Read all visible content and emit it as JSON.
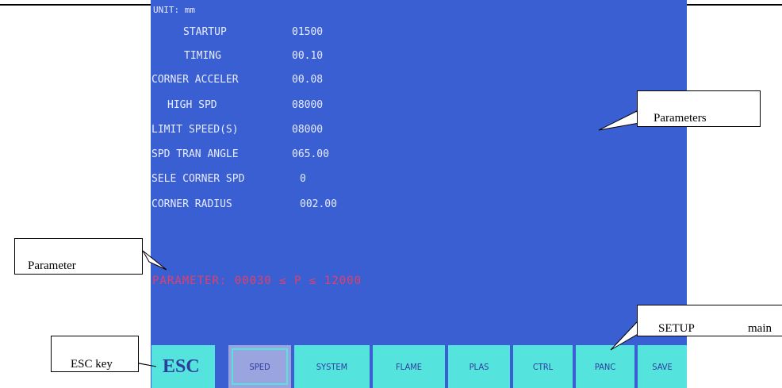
{
  "screen": {
    "unit": "UNIT: mm",
    "params": [
      {
        "label": "STARTUP",
        "value": "01500"
      },
      {
        "label": "TIMING",
        "value": "00.10"
      },
      {
        "label": "CORNER ACCELER",
        "value": "00.08"
      },
      {
        "label": "HIGH SPD",
        "value": "08000"
      },
      {
        "label": "LIMIT SPEED(S)",
        "value": "08000"
      },
      {
        "label": "SPD TRAN ANGLE",
        "value": "065.00"
      },
      {
        "label": "SELE CORNER SPD",
        "value": "0"
      },
      {
        "label": "CORNER RADIUS",
        "value": "002.00"
      }
    ],
    "range_text": "PARAMETER: 00030 ≤ P ≤ 12000"
  },
  "function_keys": [
    {
      "label": "ESC"
    },
    {
      "label": "SPED",
      "active": true
    },
    {
      "label": "SYSTEM"
    },
    {
      "label": "FLAME"
    },
    {
      "label": "PLAS"
    },
    {
      "label": "CTRL"
    },
    {
      "label": "PANC"
    },
    {
      "label": "SAVE"
    }
  ],
  "callouts": {
    "parameters": "Parameters",
    "parameter": "Parameter",
    "esc_key": "ESC key",
    "setup": "SETUP",
    "setup_suffix": "main"
  },
  "colors": {
    "screen_bg": "#3a5fd3",
    "key_bg": "#55e3dd",
    "active_key_bg": "#9aa4de",
    "range_text": "#e0406a"
  }
}
